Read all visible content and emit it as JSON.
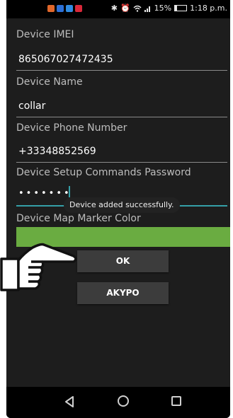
{
  "status_bar": {
    "battery_text": "15%",
    "time": "1:18 p.m.",
    "app_icon_colors": [
      "#e0672b",
      "#2c6fd6",
      "#2f8be0",
      "#d9283a"
    ]
  },
  "form": {
    "imei": {
      "label": "Device IMEI",
      "value": "865067027472435"
    },
    "name": {
      "label": "Device Name",
      "value": "collar"
    },
    "phone": {
      "label": "Device Phone Number",
      "value": "+33348852569"
    },
    "password": {
      "label": "Device Setup Commands Password",
      "value": "•••••••"
    },
    "marker_color": {
      "label": "Device Map Marker Color",
      "color": "#6aac41"
    }
  },
  "toast": {
    "text": "Device added successfully."
  },
  "buttons": {
    "ok": "OK",
    "cancel": "AKYPO"
  },
  "nav": {
    "icons": [
      "back-icon",
      "home-icon",
      "recent-apps-icon"
    ]
  },
  "overlay": {
    "icon": "pointing-hand-icon"
  }
}
